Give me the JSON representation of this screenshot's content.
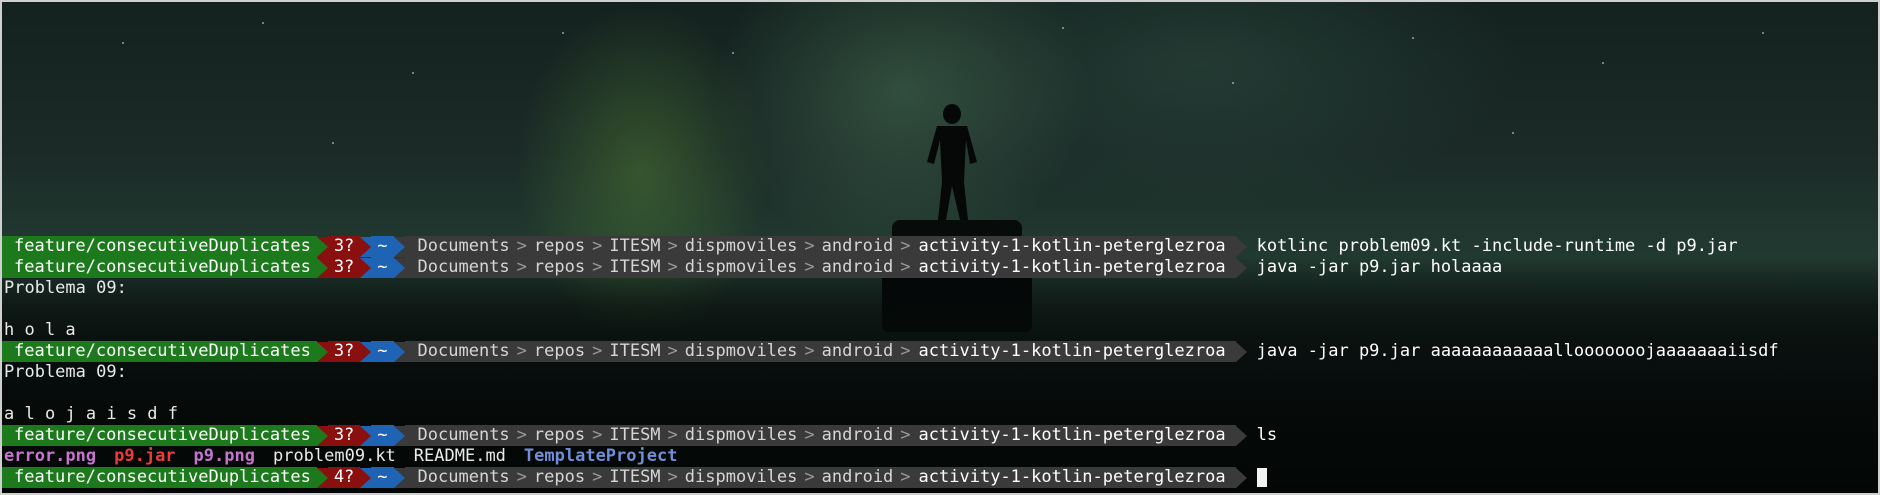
{
  "prompt": {
    "branch": "feature/consecutiveDuplicates",
    "home": "~",
    "path": [
      "Documents",
      "repos",
      "ITESM",
      "dispmoviles",
      "android"
    ],
    "cwd": "activity-1-kotlin-peterglezroa",
    "separator": ">"
  },
  "lines": [
    {
      "status": "3?",
      "command": "kotlinc problem09.kt -include-runtime -d p9.jar"
    },
    {
      "status": "3?",
      "command": "java -jar p9.jar holaaaa"
    },
    {
      "output": "Problema 09:"
    },
    {
      "output": ""
    },
    {
      "output": "h o l a"
    },
    {
      "status": "3?",
      "command": "java -jar p9.jar aaaaaaaaaaaallooooooojaaaaaaaiisdf"
    },
    {
      "output": "Problema 09:"
    },
    {
      "output": ""
    },
    {
      "output": "a l o j a i s d f"
    },
    {
      "status": "3?",
      "command": "ls"
    },
    {
      "ls": [
        "error.png",
        "p9.jar",
        "p9.png",
        "problem09.kt",
        "README.md",
        "TemplateProject"
      ]
    },
    {
      "status": "4?",
      "command": ""
    }
  ],
  "colors": {
    "branch_bg": "#1c7a1c",
    "status_bg": "#8a1010",
    "home_bg": "#1f64b4",
    "path_bg": "#3a3a3a"
  }
}
